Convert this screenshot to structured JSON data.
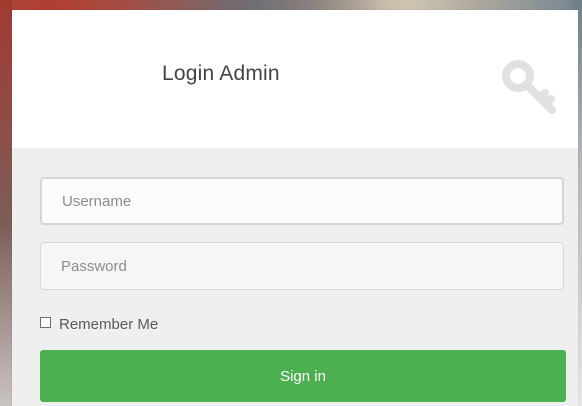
{
  "login": {
    "title": "Login Admin",
    "username_placeholder": "Username",
    "password_placeholder": "Password",
    "remember_label": "Remember Me",
    "signin_label": "Sign in",
    "accent_color": "#4CAF50",
    "icon": "key-icon"
  }
}
